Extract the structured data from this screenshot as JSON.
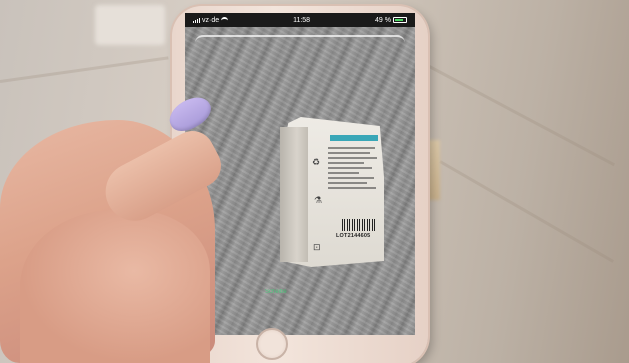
{
  "photo": {
    "description_colors": {
      "background_wood": "#cdc3b8",
      "phone_rose_gold": "#efdcd2",
      "nail_polish": "#b9aae4",
      "label_teal": "#39a7b7",
      "scan_hint_green": "#45d07a"
    }
  },
  "phone_screen": {
    "status_bar": {
      "carrier": "vz·de",
      "time": "11:58",
      "battery_percent": "49 %"
    },
    "sachet_label": {
      "lot_code": "LOT2144605"
    },
    "scan_hint": "Scheibe"
  },
  "icons": [
    "signal-icon",
    "wifi-icon",
    "battery-icon",
    "home-button-icon"
  ]
}
